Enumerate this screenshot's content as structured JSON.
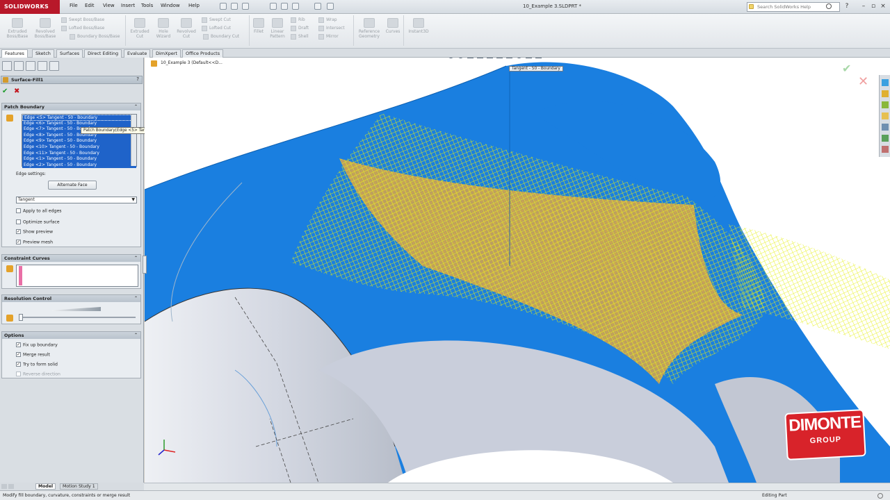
{
  "app": {
    "logo": "SOLIDWORKS",
    "doc_title": "10_Example 3.SLDPRT *",
    "menu": [
      "File",
      "Edit",
      "View",
      "Insert",
      "Tools",
      "Window",
      "Help"
    ],
    "search_placeholder": "Search SolidWorks Help"
  },
  "ribbon": {
    "big": [
      "Extruded Boss/Base",
      "Revolved Boss/Base",
      "Extruded Cut",
      "Hole Wizard",
      "Revolved Cut",
      "Fillet",
      "Linear Pattern",
      "Reference Geometry",
      "Curves",
      "Instant3D"
    ],
    "small_group1": [
      "Swept Boss/Base",
      "Lofted Boss/Base",
      "Boundary Boss/Base"
    ],
    "small_group2": [
      "Swept Cut",
      "Lofted Cut",
      "Boundary Cut"
    ],
    "small_group3": [
      "Rib",
      "Draft",
      "Shell"
    ],
    "small_group4": [
      "Wrap",
      "Intersect",
      "Mirror"
    ]
  },
  "tabs": [
    "Features",
    "Sketch",
    "Surfaces",
    "Direct Editing",
    "Evaluate",
    "DimXpert",
    "Office Products"
  ],
  "pm": {
    "title": "Surface-Fill1",
    "patch_boundary": {
      "header": "Patch Boundary",
      "edges": [
        "Edge <5> Tangent - 50 - Boundary",
        "Edge <6> Tangent - 50 - Boundary",
        "Edge <7> Tangent - 50 - Boundary",
        "Edge <8> Tangent - 50 - Boundary",
        "Edge <9> Tangent - 50 - Boundary",
        "Edge <10> Tangent - 50 - Boundary",
        "Edge <11> Tangent - 50 - Boundary",
        "Edge <1> Tangent - 50 - Boundary",
        "Edge <2> Tangent - 50 - Boundary"
      ],
      "tooltip": "Patch Boundary(Edge <5> Tangent - 50 - Boundary)",
      "edge_settings_label": "Edge settings:",
      "alternate_face": "Alternate Face",
      "curvature_select": "Tangent",
      "checkboxes": [
        {
          "label": "Apply to all edges",
          "checked": false
        },
        {
          "label": "Optimize surface",
          "checked": false
        },
        {
          "label": "Show preview",
          "checked": true
        },
        {
          "label": "Preview mesh",
          "checked": true
        }
      ]
    },
    "constraint_curves": {
      "header": "Constraint Curves"
    },
    "resolution": {
      "header": "Resolution Control"
    },
    "options": {
      "header": "Options",
      "checkboxes": [
        {
          "label": "Fix up boundary",
          "checked": true
        },
        {
          "label": "Merge result",
          "checked": true
        },
        {
          "label": "Try to form solid",
          "checked": true
        },
        {
          "label": "Reverse direction",
          "checked": false
        }
      ]
    }
  },
  "viewport": {
    "tree_label": "10_Example 3  (Default<<D...",
    "callout": "Tangent - 50 - Boundary",
    "brand_line1": "DIMONTE",
    "brand_line2": "GROUP"
  },
  "bottom_tabs": [
    "Model",
    "Motion Study 1"
  ],
  "status": {
    "message": "Modify fill boundary, curvature, constraints or merge result",
    "mode": "Editing Part"
  }
}
